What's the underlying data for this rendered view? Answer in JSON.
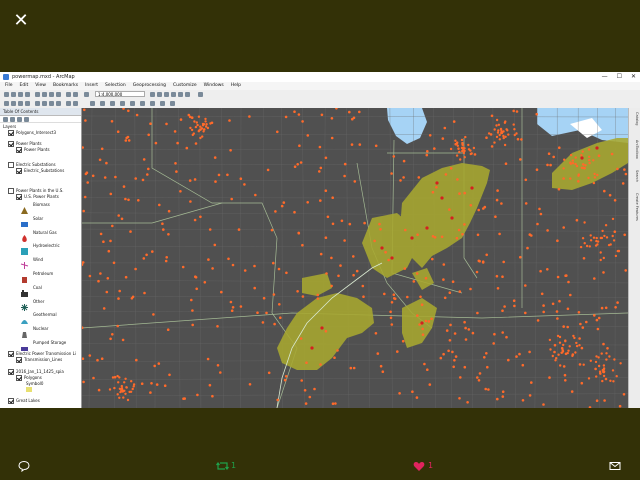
{
  "viewer": {
    "close_glyph": "✕"
  },
  "window": {
    "title": "powermap.mxd - ArcMap",
    "controls": [
      "—",
      "☐",
      "✕"
    ]
  },
  "menu": [
    "File",
    "Edit",
    "View",
    "Bookmarks",
    "Insert",
    "Selection",
    "Geoprocessing",
    "Customize",
    "Windows",
    "Help"
  ],
  "toolbar": {
    "scale": "1:4,000,000"
  },
  "toc": {
    "title": "Table Of Contents",
    "root": "Layers",
    "groups": [
      {
        "label": "Polygons_Intersect3",
        "checked": true
      },
      {
        "label": "Power Plants",
        "checked": true,
        "child": "Power Plants"
      },
      {
        "label": "Electric Substations",
        "checked": false,
        "child": "Electric_Substations"
      },
      {
        "label": "Power Plants in the U.S.",
        "checked": false,
        "child": "U.S. Power Plants"
      }
    ],
    "legend": [
      "Biomass",
      "Solar",
      "Natural Gas",
      "Hydroelectric",
      "Wind",
      "Petroleum",
      "Coal",
      "Other",
      "Geothermal",
      "Nuclear",
      "Pumped Storage"
    ],
    "groups2": [
      {
        "label": "Electric Power Transmission Li",
        "checked": true,
        "child": "Transmission_Lines"
      },
      {
        "label": "2016_Jan_11_1425_spia",
        "checked": true,
        "child": "Polygons",
        "sub": "Symbol0"
      },
      {
        "label": "Great Lakes",
        "checked": true
      }
    ]
  },
  "dock": [
    "Catalog",
    "ArcToolbox",
    "Search",
    "Create Features"
  ],
  "social": {
    "retweets": "1",
    "likes": "1"
  },
  "colors": {
    "frame": "#333107",
    "map_bg": "#505050",
    "ice_polygon": "#a8a830",
    "plant_dot": "#ff6a2a",
    "lake": "#a6d3f5",
    "retweet": "#1fa14a",
    "like": "#e0245e"
  }
}
